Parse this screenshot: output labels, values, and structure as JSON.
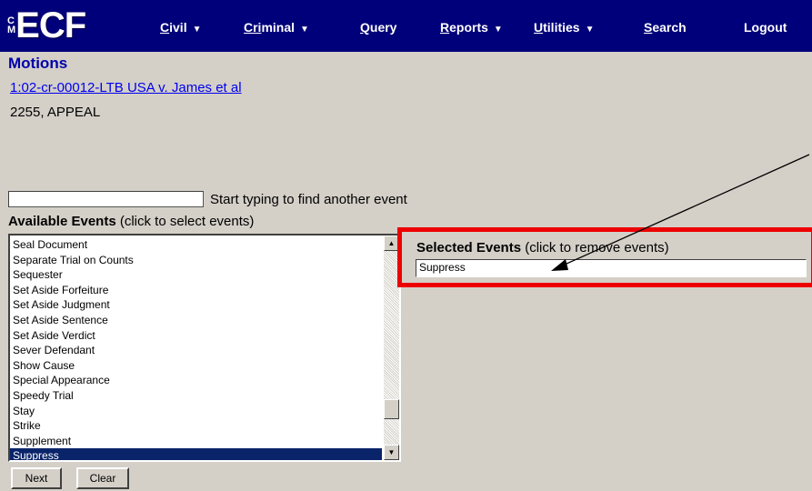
{
  "nav": {
    "logo_prefix": "CM",
    "logo": "ECF",
    "menu": [
      {
        "label": "Civil",
        "underline": "C",
        "rest": "ivil",
        "dropdown": true
      },
      {
        "label": "Criminal",
        "underline": "Cri",
        "rest": "minal",
        "dropdown": true
      },
      {
        "label": "Query",
        "underline": "Q",
        "rest": "uery",
        "dropdown": false
      },
      {
        "label": "Reports",
        "underline": "R",
        "rest": "eports",
        "dropdown": true
      },
      {
        "label": "Utilities",
        "underline": "U",
        "rest": "tilities",
        "dropdown": true
      },
      {
        "label": "Search",
        "underline": "S",
        "rest": "earch",
        "dropdown": false
      },
      {
        "label": "Logout",
        "underline": "",
        "rest": "Logout",
        "dropdown": false
      }
    ]
  },
  "page": {
    "title": "Motions",
    "case_link": "1:02-cr-00012-LTB USA v. James et al",
    "case_info": "2255, APPEAL"
  },
  "finder": {
    "value": "",
    "label": "Start typing to find another event"
  },
  "available": {
    "heading": "Available Events",
    "hint": "(click to select events)",
    "items": [
      "Seal Document",
      "Separate Trial on Counts",
      "Sequester",
      "Set Aside Forfeiture",
      "Set Aside Judgment",
      "Set Aside Sentence",
      "Set Aside Verdict",
      "Sever Defendant",
      "Show Cause",
      "Special Appearance",
      "Speedy Trial",
      "Stay",
      "Strike",
      "Supplement",
      "Suppress"
    ],
    "selected_index": 14
  },
  "selected": {
    "heading": "Selected Events",
    "hint": "(click to remove events)",
    "items": [
      "Suppress"
    ]
  },
  "buttons": {
    "next": "Next",
    "clear": "Clear"
  },
  "colors": {
    "nav_bg": "#00007a",
    "highlight": "#ee0000",
    "selection_bg": "#0a246a"
  }
}
